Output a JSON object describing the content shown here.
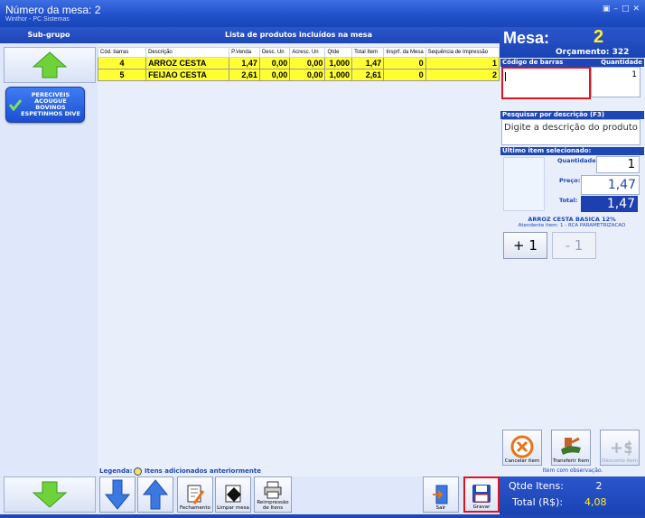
{
  "window": {
    "title": "Número da mesa: 2",
    "subtitle": "Winthor - PC Sistemas",
    "controls": [
      "▣",
      "–",
      "□",
      "✕"
    ]
  },
  "subgroup": {
    "header": "Sub-grupo",
    "categories": [
      {
        "label": "PERECIVEIS ACOUGUE BOVINOS ESPETINHOS DIVE"
      }
    ]
  },
  "products": {
    "header": "Lista de produtos incluídos na mesa",
    "columns": [
      "Cód. barras",
      "Descrição",
      "P.Venda",
      "Desc. Un",
      "Acresc. Un",
      "Qtde",
      "Total Item",
      "Insprf. da Mesa",
      "Sequência de Impressão"
    ],
    "rows": [
      {
        "code": "4",
        "desc": "ARROZ CESTA",
        "price": "1,47",
        "disc": "0,00",
        "add": "0,00",
        "qty": "1,000",
        "total": "1,47",
        "insp": "0",
        "seq": "1"
      },
      {
        "code": "5",
        "desc": "FEIJAO CESTA",
        "price": "2,61",
        "disc": "0,00",
        "add": "0,00",
        "qty": "1,000",
        "total": "2,61",
        "insp": "0",
        "seq": "2"
      }
    ]
  },
  "mesa": {
    "label": "Mesa:",
    "number": "2",
    "orcamento": "Orçamento: 322",
    "barcode_label": "Código de barras",
    "quantity_label": "Quantidade",
    "quantity_value": "1",
    "search_label": "Pesquisar por descrição (F3)",
    "search_placeholder": "Digite a descrição do produto",
    "last_item_label": "Último item selecionado:",
    "qty_label": "Quantidade:",
    "qty_value": "1",
    "price_label": "Preço:",
    "price_value": "1,47",
    "total_label": "Total:",
    "total_value": "1,47",
    "item_name": "ARROZ CESTA BASICA 12%",
    "attendant": "Atendente item: 1 - RCA PARAMETRIZACAO",
    "plus_label": "+ 1",
    "minus_label": "- 1"
  },
  "actions": {
    "cancel": "Cancelar item",
    "transfer": "Transferir Item",
    "discount": "Desconto item",
    "note": "Item com observação."
  },
  "legend": {
    "label": "Legenda:",
    "text": "Itens adicionados anteriormente"
  },
  "toolbar": {
    "fechamento": "Fechamento",
    "limpar": "Limpar mesa",
    "reimpressao": "Reimpressão de Itens",
    "sair": "Sair",
    "gravar": "Gravar"
  },
  "totals": {
    "qty_label": "Qtde Itens:",
    "qty_value": "2",
    "total_label": "Total (R$):",
    "total_value": "4,08"
  },
  "colors": {
    "accent": "#1e46b5",
    "row_highlight": "#ffff33",
    "legend_dot": "#ffe14a",
    "arrow_green": "#6fd23b",
    "arrow_blue": "#3b78e0",
    "total_bg": "#1d3fb0"
  }
}
